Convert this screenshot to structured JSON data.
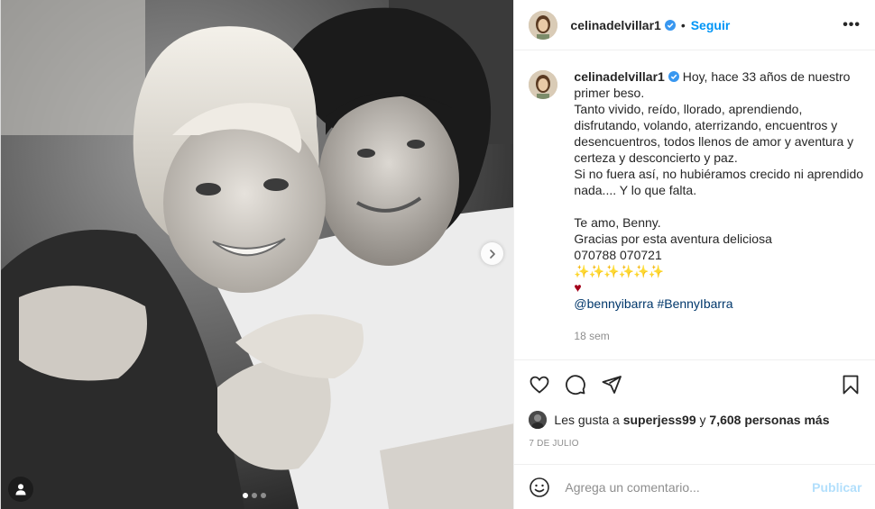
{
  "header": {
    "username": "celinadelvillar1",
    "separator": "•",
    "follow_label": "Seguir",
    "more_label": "•••"
  },
  "caption": {
    "username": "celinadelvillar1",
    "lines": [
      "Hoy, hace 33 años de nuestro",
      "primer beso.",
      "Tanto vivido, reído, llorado, aprendiendo,",
      "disfrutando, volando, aterrizando, encuentros y",
      "desencuentros, todos llenos de amor y aventura y",
      "certeza y desconcierto y paz.",
      "Si no fuera así, no hubiéramos crecido ni aprendido",
      "nada.... Y lo que falta.",
      "",
      "Te amo, Benny.",
      "Gracias por esta aventura deliciosa",
      "070788 070721",
      "✨✨✨✨✨✨",
      "♥"
    ],
    "mentions": "@bennyibarra #BennyIbarra",
    "time_ago": "18 sem"
  },
  "likes": {
    "prefix": "Les gusta a",
    "user": "superjess99",
    "connector": "y",
    "count": "7,608 personas más"
  },
  "date": "7 DE JULIO",
  "comment": {
    "placeholder": "Agrega un comentario...",
    "publish_label": "Publicar"
  },
  "carousel": {
    "total": 3,
    "active": 1
  },
  "colors": {
    "link_blue": "#0095f6",
    "mention_blue": "#00376b",
    "publish_disabled": "#b2dffc",
    "muted_gray": "#8e8e8e",
    "verified_blue": "#3897f0"
  }
}
